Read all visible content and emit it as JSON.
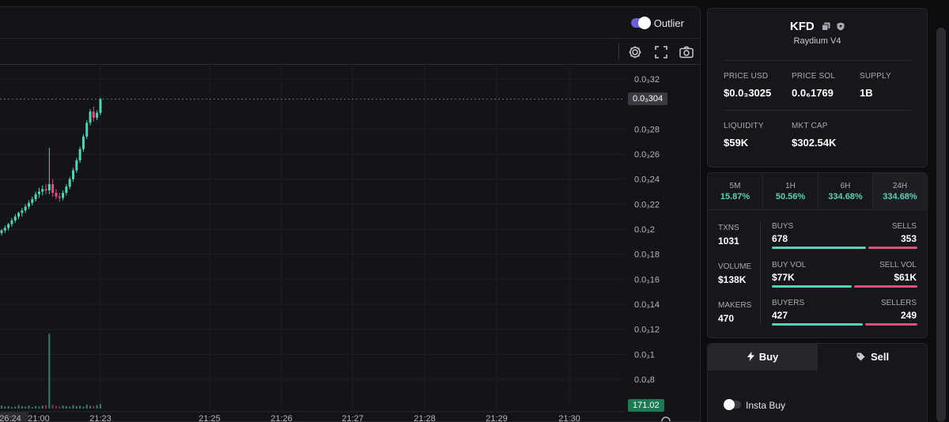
{
  "chart_header": {
    "outlier_label": "Outlier",
    "outlier_on": true
  },
  "toolbar_icons": [
    "gear-icon",
    "fullscreen-icon",
    "camera-icon"
  ],
  "colors": {
    "up": "#5ad1b4",
    "down": "#e0507a",
    "accent": "#6d5fd6",
    "current_price_tag": "#3a3b42",
    "volume_tag": "#1e7a55"
  },
  "chart_data": {
    "type": "candlestick",
    "y_ticks": [
      "0.0₃32",
      "0.0₃28",
      "0.0₃26",
      "0.0₃24",
      "0.0₃22",
      "0.0₃2",
      "0.0₃18",
      "0.0₃16",
      "0.0₃14",
      "0.0₃12",
      "0.0₃1",
      "0.0₄8"
    ],
    "y_tick_values": [
      0.00032,
      0.00028,
      0.00026,
      0.00024,
      0.00022,
      0.0002,
      0.00018,
      0.00016,
      0.00014,
      0.00012,
      0.0001,
      8e-05
    ],
    "ylim": [
      7.35e-05,
      0.000333
    ],
    "x_ticks": [
      "26:24",
      "21:00",
      "21:23",
      "21:25",
      "21:26",
      "21:27",
      "21:28",
      "21:29",
      "21:30"
    ],
    "current_price_label": "0.0₃304",
    "current_price": 0.000304,
    "volume_label": "171.02",
    "grid": true,
    "candles": [
      [
        0.000197,
        0.0002,
        0.000195,
        0.000199
      ],
      [
        0.000199,
        0.000203,
        0.000197,
        0.000201
      ],
      [
        0.000201,
        0.000205,
        0.000199,
        0.000204
      ],
      [
        0.000204,
        0.000209,
        0.000202,
        0.000207
      ],
      [
        0.000207,
        0.000212,
        0.000205,
        0.00021
      ],
      [
        0.00021,
        0.000214,
        0.000208,
        0.000213
      ],
      [
        0.000213,
        0.000217,
        0.00021,
        0.000215
      ],
      [
        0.000215,
        0.00022,
        0.000213,
        0.000218
      ],
      [
        0.000218,
        0.000223,
        0.000216,
        0.000221
      ],
      [
        0.000221,
        0.000226,
        0.000219,
        0.000224
      ],
      [
        0.000224,
        0.00023,
        0.000222,
        0.000228
      ],
      [
        0.000228,
        0.000233,
        0.000225,
        0.00023
      ],
      [
        0.00023,
        0.000235,
        0.000227,
        0.000232
      ],
      [
        0.000232,
        0.000236,
        0.000228,
        0.000231
      ],
      [
        0.000231,
        0.000265,
        0.000228,
        0.000236
      ],
      [
        0.000236,
        0.00024,
        0.000226,
        0.000229
      ],
      [
        0.000229,
        0.000232,
        0.000224,
        0.000226
      ],
      [
        0.000226,
        0.000229,
        0.000222,
        0.000225
      ],
      [
        0.000225,
        0.000231,
        0.000223,
        0.000229
      ],
      [
        0.000229,
        0.000236,
        0.000227,
        0.000234
      ],
      [
        0.000234,
        0.000242,
        0.000232,
        0.00024
      ],
      [
        0.00024,
        0.000249,
        0.000238,
        0.000247
      ],
      [
        0.000247,
        0.000257,
        0.000245,
        0.000255
      ],
      [
        0.000255,
        0.000266,
        0.000253,
        0.000264
      ],
      [
        0.000264,
        0.000276,
        0.000262,
        0.000274
      ],
      [
        0.000274,
        0.000287,
        0.000272,
        0.000285
      ],
      [
        0.000285,
        0.000296,
        0.000283,
        0.000294
      ],
      [
        0.000294,
        0.000298,
        0.000286,
        0.000289
      ],
      [
        0.000289,
        0.000295,
        0.000287,
        0.000293
      ],
      [
        0.000293,
        0.000305,
        0.000291,
        0.000304
      ]
    ],
    "volumes": [
      6,
      4,
      5,
      3,
      4,
      7,
      5,
      4,
      6,
      3,
      5,
      4,
      6,
      7,
      150,
      8,
      5,
      4,
      6,
      5,
      4,
      7,
      5,
      6,
      4,
      8,
      6,
      5,
      7,
      9
    ],
    "volume_max": 171.02
  },
  "token": {
    "symbol": "KFD",
    "dex": "Raydium V4",
    "price_usd_label": "PRICE USD",
    "price_usd": "$0.0₃3025",
    "price_sol_label": "PRICE SOL",
    "price_sol": "0.0₆1769",
    "supply_label": "SUPPLY",
    "supply": "1B",
    "liquidity_label": "LIQUIDITY",
    "liquidity": "$59K",
    "mktcap_label": "MKT CAP",
    "mktcap": "$302.54K"
  },
  "timeframes": [
    {
      "label": "5M",
      "value": "15.87%"
    },
    {
      "label": "1H",
      "value": "50.56%"
    },
    {
      "label": "6H",
      "value": "334.68%"
    },
    {
      "label": "24H",
      "value": "334.68%"
    }
  ],
  "txns": {
    "txns_label": "TXNS",
    "txns": "1031",
    "volume_label": "VOLUME",
    "volume": "$138K",
    "makers_label": "MAKERS",
    "makers": "470",
    "buys_label": "BUYS",
    "buys": "678",
    "sells_label": "SELLS",
    "sells": "353",
    "buyvol_label": "BUY VOL",
    "buyvol": "$77K",
    "sellvol_label": "SELL VOL",
    "sellvol": "$61K",
    "buyers_label": "BUYERS",
    "buyers": "427",
    "sellers_label": "SELLERS",
    "sellers": "249",
    "buys_ratio": 0.657,
    "buyvol_ratio": 0.558,
    "buyers_ratio": 0.632
  },
  "trade": {
    "buy_label": "Buy",
    "sell_label": "Sell",
    "insta_buy_label": "Insta Buy",
    "insta_buy_on": false
  }
}
